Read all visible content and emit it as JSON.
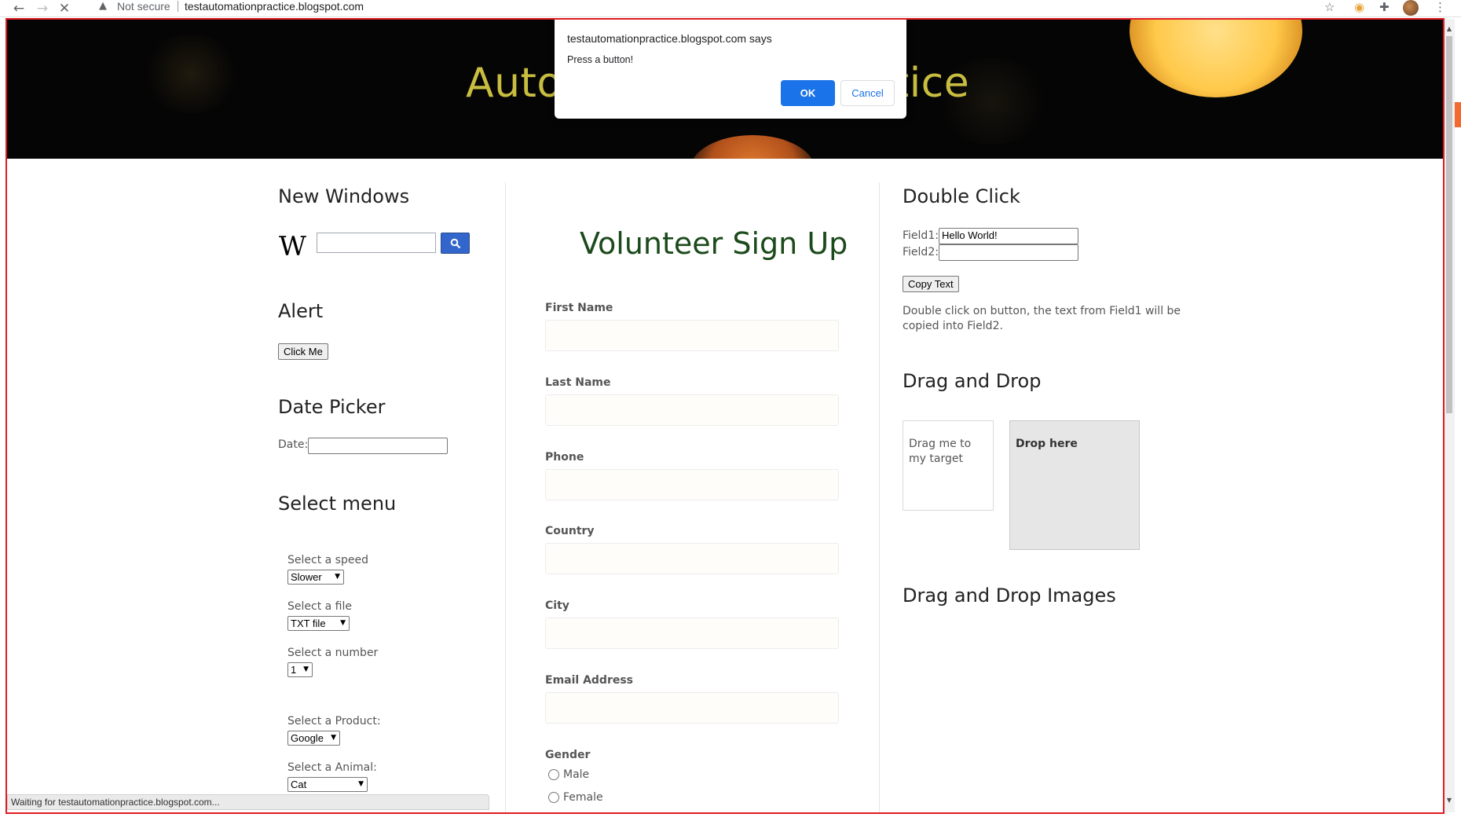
{
  "browser": {
    "security_label": "Not secure",
    "url": "testautomationpractice.blogspot.com",
    "status": "Waiting for testautomationpractice.blogspot.com..."
  },
  "banner": {
    "title_visible_left": "Auto",
    "title_visible_right": "ctice"
  },
  "alert_dialog": {
    "title": "testautomationpractice.blogspot.com says",
    "message": "Press a button!",
    "ok_label": "OK",
    "cancel_label": "Cancel"
  },
  "left_column": {
    "new_windows": {
      "heading": "New Windows",
      "logo": "W"
    },
    "alert": {
      "heading": "Alert",
      "button_label": "Click Me"
    },
    "date_picker": {
      "heading": "Date Picker",
      "label": "Date:",
      "value": ""
    },
    "select_menu": {
      "heading": "Select menu",
      "speed": {
        "label": "Select a speed",
        "selected": "Slower"
      },
      "file": {
        "label": "Select a file",
        "selected": "TXT file"
      },
      "number": {
        "label": "Select a number",
        "selected": "1"
      },
      "product": {
        "label": "Select a Product:",
        "selected": "Google"
      },
      "animal": {
        "label": "Select a Animal:",
        "selected": "Cat"
      }
    }
  },
  "middle_column": {
    "title": "Volunteer Sign Up",
    "fields": [
      {
        "label": "First Name",
        "value": ""
      },
      {
        "label": "Last Name",
        "value": ""
      },
      {
        "label": "Phone",
        "value": ""
      },
      {
        "label": "Country",
        "value": ""
      },
      {
        "label": "City",
        "value": ""
      },
      {
        "label": "Email Address",
        "value": ""
      }
    ],
    "gender": {
      "label": "Gender",
      "options": [
        "Male",
        "Female"
      ]
    }
  },
  "right_column": {
    "double_click": {
      "heading": "Double Click",
      "field1_label": "Field1:",
      "field1_value": "Hello World!",
      "field2_label": "Field2:",
      "field2_value": "",
      "button_label": "Copy Text",
      "description": "Double click on button, the text from Field1 will be copied into Field2."
    },
    "drag_drop": {
      "heading": "Drag and Drop",
      "drag_text": "Drag me to my target",
      "drop_text": "Drop here"
    },
    "drag_drop_images": {
      "heading": "Drag and Drop Images"
    }
  },
  "colors": {
    "frame_red": "#e11b22",
    "banner_title": "#c9bd40",
    "volunteer_title": "#1b4a1b",
    "dialog_ok": "#1a73e8",
    "wiki_search": "#3366cc"
  }
}
